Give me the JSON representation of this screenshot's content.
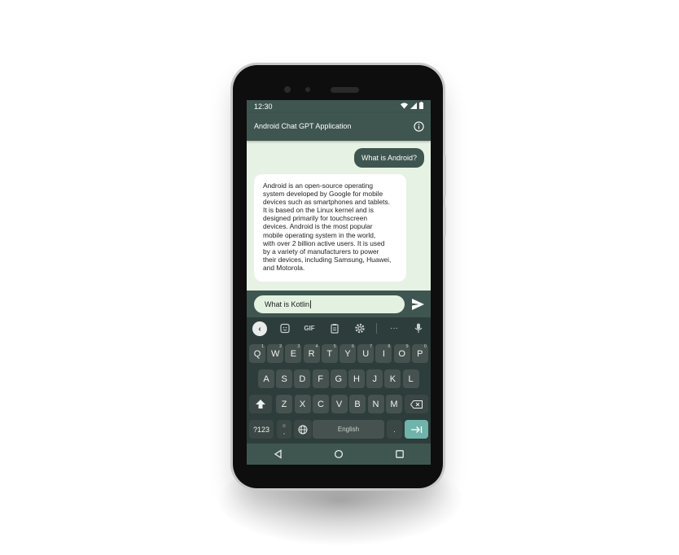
{
  "status_bar": {
    "time": "12:30",
    "icons": [
      "wifi-icon",
      "signal-icon",
      "battery-icon"
    ]
  },
  "app_bar": {
    "title": "Android Chat GPT Application",
    "info_icon": "info-icon"
  },
  "chat": {
    "user_message": "What is Android?",
    "bot_message_lines": [
      "Android is an open-source operating",
      "system developed by Google for mobile",
      "devices such as smartphones and tablets.",
      "It is based on the Linux kernel and is",
      "designed primarily for touchscreen",
      "devices. Android is the most popular",
      "mobile operating system in the world,",
      "with over 2 billion active users. It is used",
      "by a variety of manufacturers to power",
      "their devices, including Samsung, Huawei,",
      "and Motorola."
    ]
  },
  "composer": {
    "input_value": "What is Kotlin",
    "send_icon": "send-icon"
  },
  "keyboard": {
    "toolbar": {
      "back": "‹",
      "sticker": "sticker-icon",
      "gif": "GIF",
      "clipboard": "clipboard-icon",
      "settings": "gear-icon",
      "more": "···",
      "mic": "mic-icon"
    },
    "row1": [
      {
        "label": "Q",
        "hint": "1"
      },
      {
        "label": "W",
        "hint": "2"
      },
      {
        "label": "E",
        "hint": "3"
      },
      {
        "label": "R",
        "hint": "4"
      },
      {
        "label": "T",
        "hint": "5"
      },
      {
        "label": "Y",
        "hint": "6"
      },
      {
        "label": "U",
        "hint": "7"
      },
      {
        "label": "I",
        "hint": "8"
      },
      {
        "label": "O",
        "hint": "9"
      },
      {
        "label": "P",
        "hint": "0"
      }
    ],
    "row2": [
      "A",
      "S",
      "D",
      "F",
      "G",
      "H",
      "J",
      "K",
      "L"
    ],
    "row3": [
      "Z",
      "X",
      "C",
      "V",
      "B",
      "N",
      "M"
    ],
    "bottom": {
      "symbols": "?123",
      "emoji_comma": ",",
      "space": "English",
      "period": "."
    },
    "colors": {
      "background": "#2d3d3b",
      "key": "#46524f",
      "enter": "#6fb3aa"
    }
  },
  "nav_bar": {
    "back": "back-icon",
    "home": "home-icon",
    "recents": "recents-icon"
  },
  "colors": {
    "primary": "#3f5650",
    "chat_background": "#e6f2e4",
    "bot_bubble": "#ffffff"
  }
}
